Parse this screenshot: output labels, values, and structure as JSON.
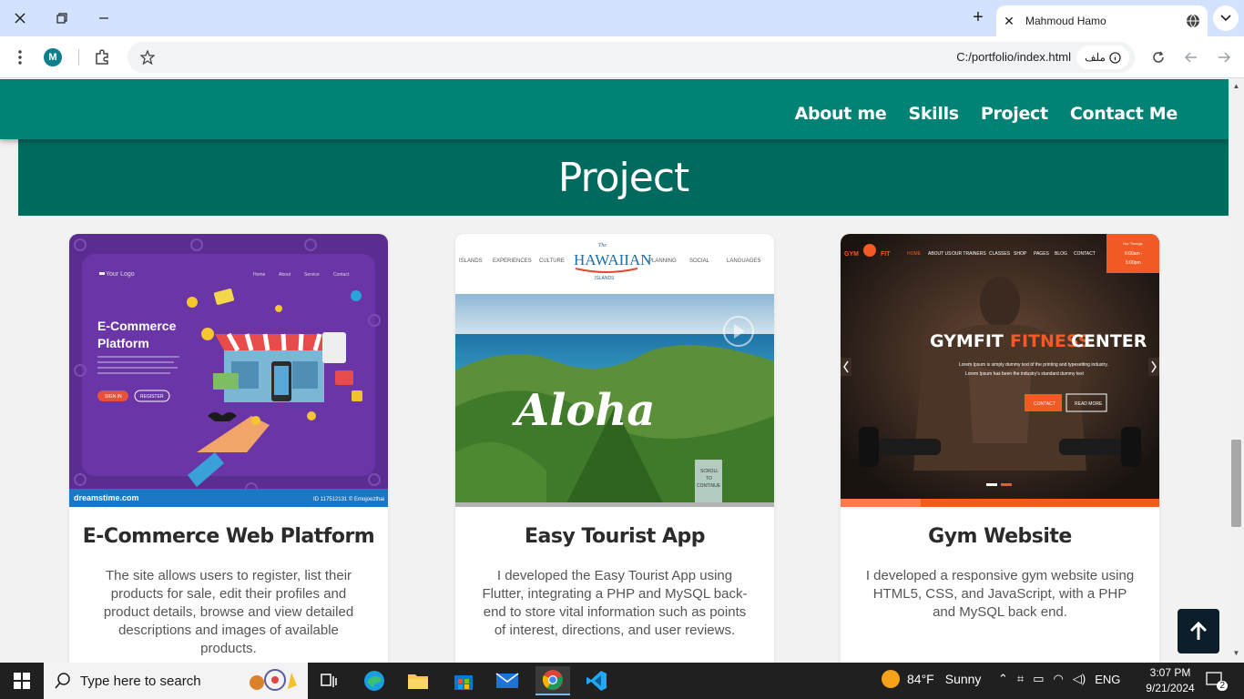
{
  "browser": {
    "tab_title": "Mahmoud Hamo",
    "profile_initial": "M",
    "url": "C:/portfolio/index.html",
    "site_chip": "ملف"
  },
  "nav": {
    "items": [
      "About me",
      "Skills",
      "Project",
      "Contact Me"
    ]
  },
  "section": {
    "title": "Project"
  },
  "cards": [
    {
      "title": "E-Commerce Web Platform",
      "description": "The site allows users to register, list their products for sale, edit their profiles and product details, browse and view detailed descriptions and images of available products.",
      "image": {
        "logo": "Your Logo",
        "menu": [
          "Home",
          "About",
          "Service",
          "Contact"
        ],
        "heading_line1": "E-Commerce",
        "heading_line2": "Platform",
        "btn1": "SIGN IN",
        "btn2": "REGISTER",
        "footer_left": "dreamstime.com",
        "footer_right": "ID 117512131 © Emojoezthai"
      }
    },
    {
      "title": "Easy Tourist App",
      "description": "I developed the Easy Tourist App using Flutter, integrating a PHP and MySQL back-end to store vital information such as points of interest, directions, and user reviews.",
      "image": {
        "menu_left": [
          "ISLANDS",
          "EXPERIENCES",
          "CULTURE"
        ],
        "brand_small": "The",
        "brand": "HAWAIIAN",
        "brand_sub": "ISLANDS",
        "menu_right": [
          "PLANNING",
          "SOCIAL",
          "LANGUAGES"
        ],
        "hero_word": "Aloha",
        "scroll_line1": "SCROLL",
        "scroll_line2": "TO",
        "scroll_line3": "CONTINUE"
      }
    },
    {
      "title": "Gym Website",
      "description": "I developed a responsive gym website using HTML5, CSS, and JavaScript, with a PHP and MySQL back end.",
      "image": {
        "brand_left": "GYM",
        "brand_right": "FIT",
        "menu": [
          "HOME",
          "ABOUT US",
          "OUR TRAINERS",
          "CLASSES",
          "SHOP",
          "PAGES",
          "BLOG",
          "CONTACT"
        ],
        "hours_label": "Our Timings",
        "hours_open": "6:00am -",
        "hours_close": "5:00pm",
        "headline_a": "GYMFIT",
        "headline_b": "FITNESS",
        "headline_c": "CENTER",
        "sub1": "Lorem Ipsum is simply dummy text of the printing and typesetting industry.",
        "sub2": "Lorem Ipsum has been the industry's standard dummy text",
        "btn1": "CONTACT",
        "btn2": "READ MORE"
      }
    }
  ],
  "taskbar": {
    "search_placeholder": "Type here to search",
    "temperature": "84°F",
    "condition": "Sunny",
    "language": "ENG",
    "time": "3:07 PM",
    "date": "9/21/2024",
    "notifications": "2"
  }
}
